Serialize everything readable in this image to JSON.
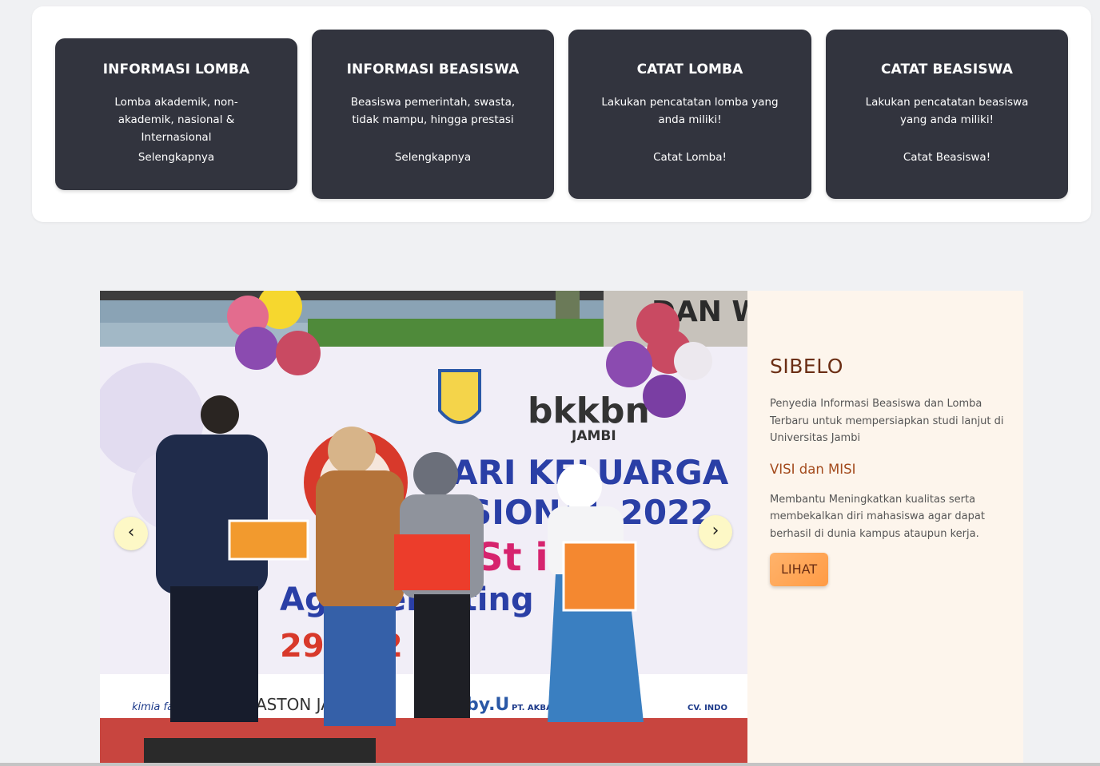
{
  "cards": [
    {
      "title": "INFORMASI LOMBA",
      "description": "Lomba akademik, non-akademik, nasional & Internasional",
      "link": "Selengkapnya"
    },
    {
      "title": "INFORMASI BEASISWA",
      "description": "Beasiswa pemerintah, swasta, tidak mampu, hingga prestasi",
      "link": "Selengkapnya"
    },
    {
      "title": "CATAT LOMBA",
      "description": "Lakukan pencatatan lomba yang anda miliki!",
      "link": "Catat Lomba!"
    },
    {
      "title": "CATAT BEASISWA",
      "description": "Lakukan pencatatan beasiswa yang anda miliki!",
      "link": "Catat Beasiswa!"
    }
  ],
  "carousel": {
    "prev_label": "‹",
    "next_label": "›",
    "photo": {
      "banner_brand": "bkkbn",
      "banner_city": "JAMBI",
      "banner_line1": "ARI KELUARGA",
      "banner_line2": "SIONAL 2022",
      "banner_line3": "St ing,",
      "banner_line4": "Aga Beba ting",
      "banner_date": "29 J i 2 2",
      "top_sign": "DAN W",
      "sponsor_1": "kimia farma",
      "sponsor_2": "ASTON JAMBI",
      "sponsor_3": "by.U",
      "sponsor_4": "PT. AKBAR NUSA",
      "sponsor_5": "CV. INDO"
    }
  },
  "info": {
    "title": "SIBELO",
    "description": "Penyedia Informasi Beasiswa dan Lomba Terbaru untuk mempersiapkan studi lanjut di Universitas Jambi",
    "vision_heading": "VISI dan MISI",
    "mission": "Membantu Meningkatkan kualitas serta membekalkan diri mahasiswa agar dapat berhasil di dunia kampus ataupun kerja.",
    "button_label": "LIHAT"
  },
  "colors": {
    "card_bg": "#32343e",
    "accent_orange": "#ff9b45",
    "title_brown": "#6b2e14",
    "hero_bg": "#fdf5ec",
    "nav_button": "#fdf8c6"
  }
}
